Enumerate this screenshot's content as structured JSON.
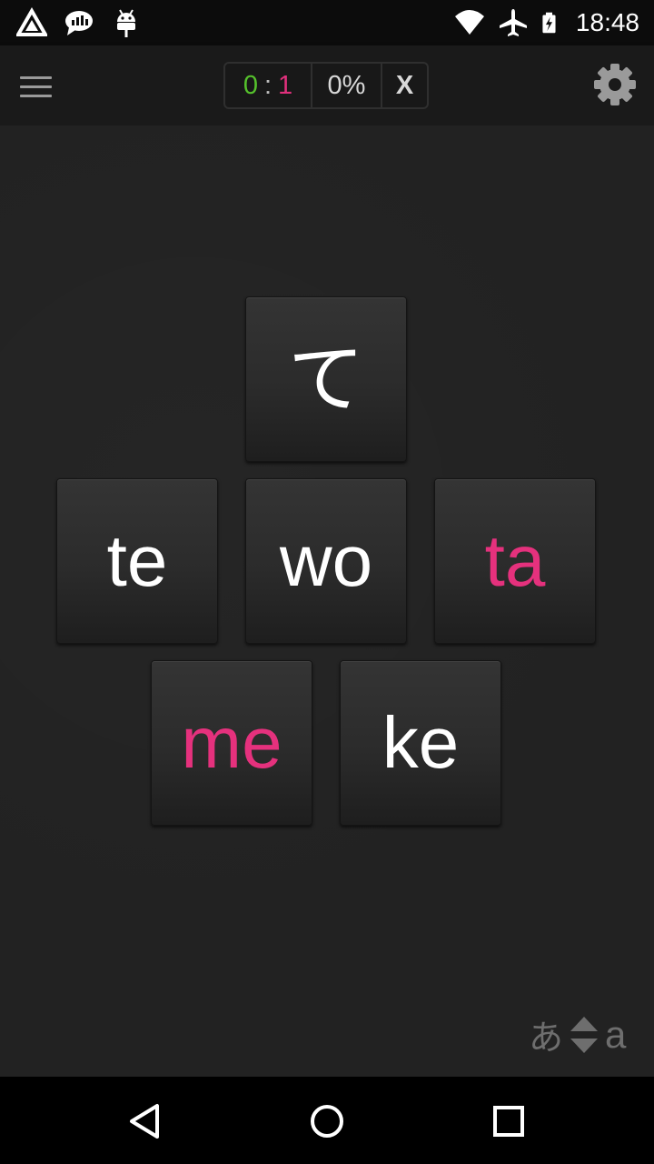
{
  "status_bar": {
    "time": "18:48",
    "left_icons": [
      "app-a-icon",
      "chat-bars-icon",
      "android-debug-icon"
    ],
    "right_icons": [
      "wifi-icon",
      "airplane-icon",
      "battery-charging-icon"
    ]
  },
  "toolbar": {
    "score": {
      "correct": "0",
      "separator": ":",
      "wrong": "1"
    },
    "percent": "0%",
    "close_label": "X",
    "colors": {
      "correct": "#55c12c",
      "wrong": "#e0307c"
    }
  },
  "quiz": {
    "prompt": "て",
    "options": [
      {
        "label": "te",
        "state": "normal"
      },
      {
        "label": "wo",
        "state": "normal"
      },
      {
        "label": "ta",
        "state": "wrong"
      },
      {
        "label": "me",
        "state": "wrong"
      },
      {
        "label": "ke",
        "state": "normal"
      }
    ],
    "colors": {
      "normal": "#ffffff",
      "wrong": "#e5317d"
    }
  },
  "mode_toggle": {
    "from": "あ",
    "to": "a"
  }
}
